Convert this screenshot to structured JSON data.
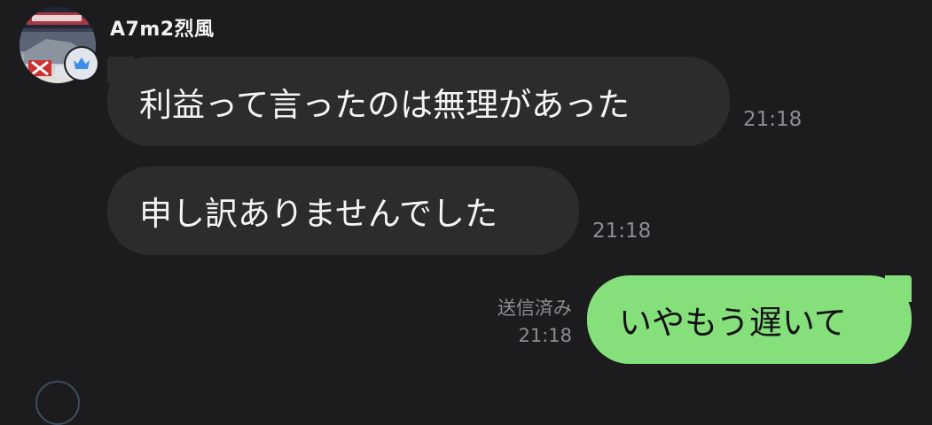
{
  "chat": {
    "sender_name": "A7m2烈風",
    "messages": [
      {
        "text": "利益って言ったのは無理があった",
        "time": "21:18"
      },
      {
        "text": "申し訳ありませんでした",
        "time": "21:18"
      }
    ],
    "reply": {
      "text": "いやもう遅いて",
      "status": "送信済み",
      "time": "21:18"
    }
  },
  "colors": {
    "background": "#1c1c1e",
    "incoming_bubble": "#2c2c2e",
    "outgoing_bubble": "#85e07c",
    "timestamp": "#8d8d92",
    "badge_crown": "#3b8ee8"
  },
  "icons": {
    "badge": "crown-icon"
  }
}
